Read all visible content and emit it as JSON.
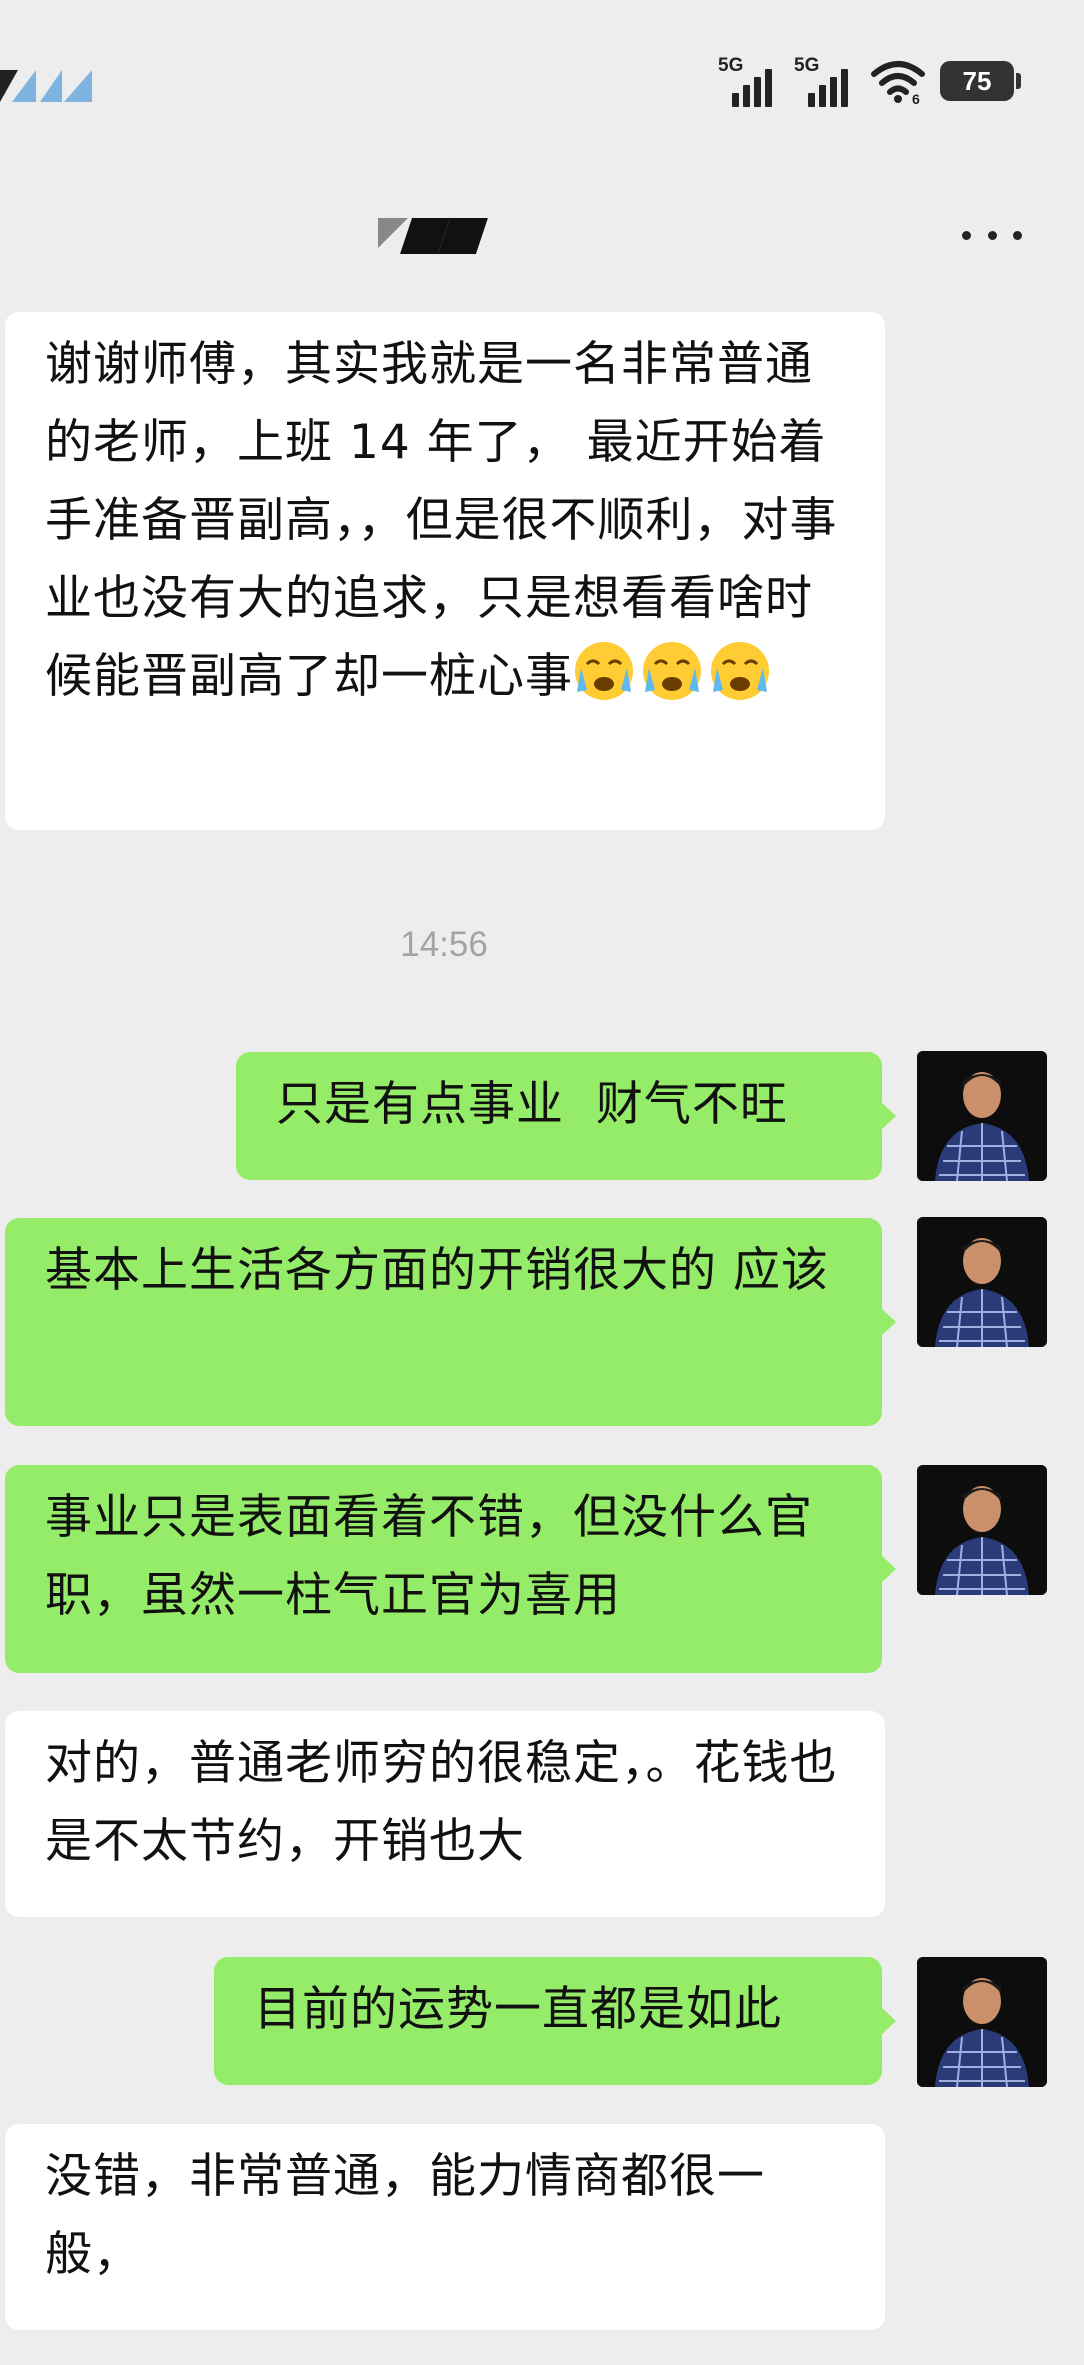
{
  "status_bar": {
    "network_1": "5G",
    "network_2": "5G",
    "battery": "75",
    "icons": [
      "signal-icon",
      "wifi-icon",
      "battery-icon"
    ]
  },
  "header": {
    "more_icon": "more-dots-icon"
  },
  "messages": [
    {
      "side": "left",
      "text": "谢谢师傅，其实我就是一名非常普通的老师，上班 14 年了， 最近开始着手准备晋副高，，但是很不顺利，对事业也没有大的追求，只是想看看啥时候能晋副高了却一桩心事",
      "emoji": "crying-face-icon x3"
    },
    {
      "side": "center",
      "timestamp": "14:56"
    },
    {
      "side": "right",
      "text": "只是有点事业  财气不旺"
    },
    {
      "side": "right",
      "text": "基本上生活各方面的开销很大的 应该"
    },
    {
      "side": "right",
      "text": "事业只是表面看着不错，但没什么官职，虽然一柱气正官为喜用"
    },
    {
      "side": "left",
      "text": "对的，普通老师穷的很稳定，。花钱也是不太节约，开销也大"
    },
    {
      "side": "right",
      "text": "目前的运势一直都是如此"
    },
    {
      "side": "left",
      "text": "没错，非常普通，能力情商都很一般，"
    }
  ],
  "colors": {
    "background": "#ededed",
    "incoming_bubble": "#ffffff",
    "outgoing_bubble": "#95ec69",
    "timestamp": "#a3a3a3"
  }
}
